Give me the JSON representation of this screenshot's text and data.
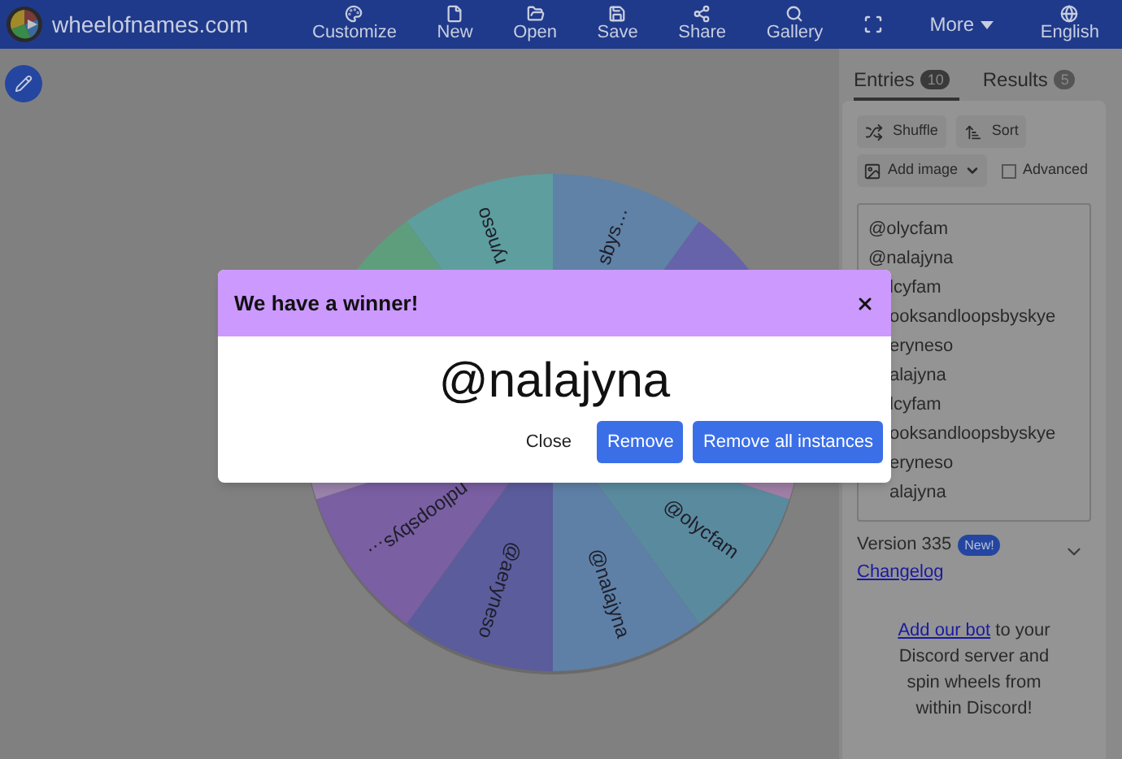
{
  "header": {
    "brand": "wheelofnames.com",
    "nav": [
      {
        "kind": "customize",
        "label": "Customize"
      },
      {
        "kind": "new",
        "label": "New"
      },
      {
        "kind": "open",
        "label": "Open"
      },
      {
        "kind": "save",
        "label": "Save"
      },
      {
        "kind": "share",
        "label": "Share"
      },
      {
        "kind": "gallery",
        "label": "Gallery"
      },
      {
        "kind": "fullscreen"
      },
      {
        "kind": "more",
        "label": "More"
      },
      {
        "kind": "language",
        "label": "English"
      }
    ]
  },
  "wheel": {
    "slices": [
      {
        "color": "#5a8a9e",
        "label": "@olycfam"
      },
      {
        "color": "#5e80a6",
        "label": "@nalajyna"
      },
      {
        "color": "#5b5c9c",
        "label": "@aeryneso"
      },
      {
        "color": "#7a5fa2",
        "label": "ndloopsbys…"
      },
      {
        "color": "#9a82aa"
      },
      {
        "color": "#5e9e7c"
      },
      {
        "color": "#5e9e9e",
        "label": "ryneso"
      },
      {
        "color": "#5f82a6",
        "label": "sbys…"
      },
      {
        "color": "#6663aa"
      },
      {
        "color": "#a07fa6"
      }
    ]
  },
  "dialog": {
    "title": "We have a winner!",
    "winner": "@nalajyna",
    "buttons": [
      {
        "kind": "text",
        "label": "Close"
      },
      {
        "kind": "primary",
        "label": "Remove"
      },
      {
        "kind": "primary",
        "label": "Remove all instances"
      }
    ]
  },
  "sidebar": {
    "tabs": [
      {
        "label": "Entries",
        "count": "10",
        "selected": true
      },
      {
        "label": "Results",
        "count": "5",
        "selected": false
      }
    ],
    "actions": [
      "Shuffle",
      "Sort",
      "Add image"
    ],
    "advanced": {
      "label": "Advanced",
      "checked": false
    },
    "entries": [
      {
        "text": "@olycfam",
        "clipped": false
      },
      {
        "text": "@nalajyna",
        "clipped": false
      },
      {
        "text": "lcyfam",
        "clipped": true
      },
      {
        "text": "ooksandloopsbyskye",
        "clipped": true
      },
      {
        "text": "eryneso",
        "clipped": true
      },
      {
        "text": "alajyna",
        "clipped": true
      },
      {
        "text": "lcyfam",
        "clipped": true
      },
      {
        "text": "ooksandloopsbyskye",
        "clipped": true
      },
      {
        "text": "eryneso",
        "clipped": true
      },
      {
        "text": "alajyna",
        "clipped": true
      }
    ],
    "version": "Version 335",
    "version_badge": "New!",
    "changelog": "Changelog",
    "discord_link": "Add our bot",
    "discord_text": "to your Discord server and spin wheels from within Discord!"
  }
}
